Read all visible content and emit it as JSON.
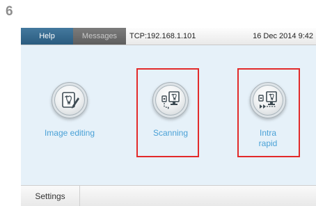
{
  "step_number": "6",
  "topbar": {
    "tabs": [
      {
        "label": "Help"
      },
      {
        "label": "Messages"
      }
    ],
    "connection": "TCP:192.168.1.101",
    "datetime": "16 Dec 2014  9:42"
  },
  "tiles": [
    {
      "label": "Image editing",
      "icon": "image-editing-icon"
    },
    {
      "label": "Scanning",
      "icon": "scanning-icon",
      "highlighted": true
    },
    {
      "label_line1": "Intra",
      "label_line2": "rapid",
      "icon": "intra-rapid-icon",
      "highlighted": true
    }
  ],
  "bottombar": {
    "settings_label": "Settings"
  },
  "colors": {
    "screen_background": "#e6f1f9",
    "help_tab": "#2a5b7f",
    "label_blue": "#4aa1d6",
    "highlight_red": "#e22a2a"
  }
}
